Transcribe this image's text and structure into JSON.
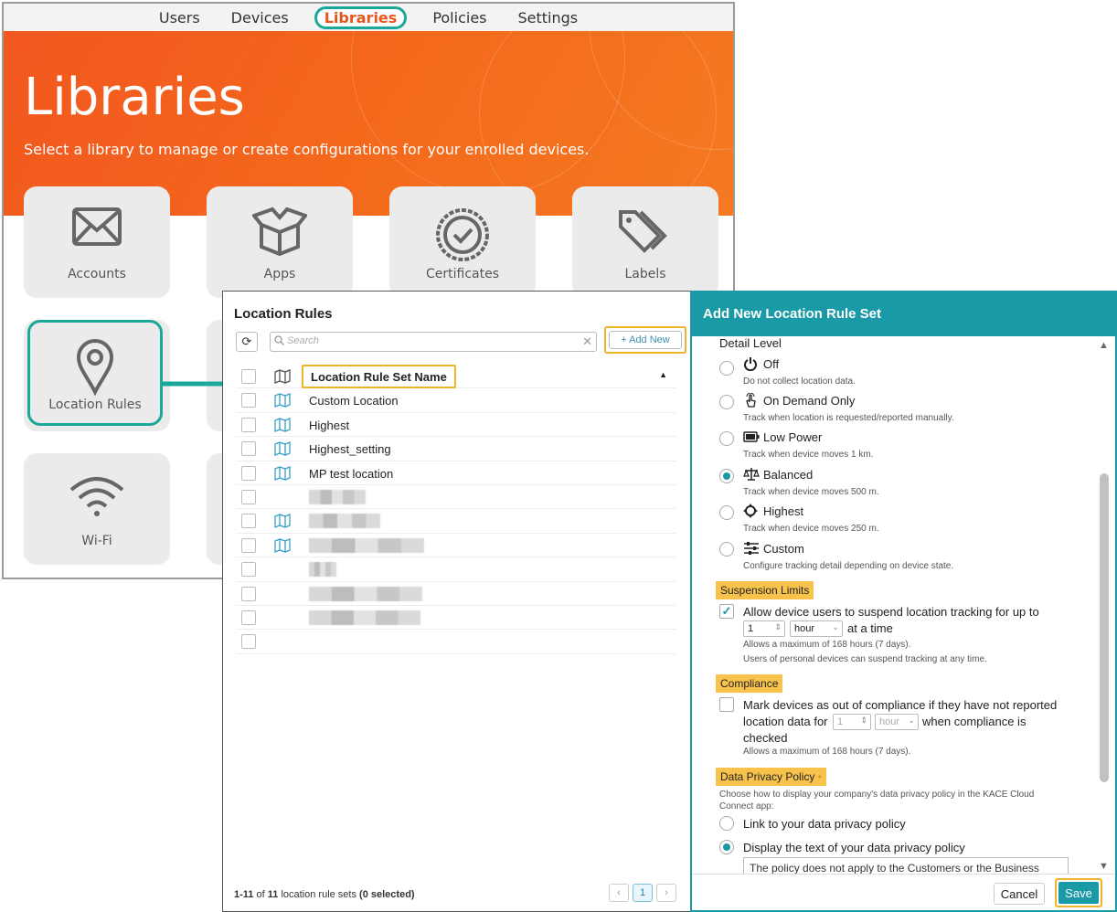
{
  "nav": {
    "items": [
      "Users",
      "Devices",
      "Libraries",
      "Policies",
      "Settings"
    ],
    "active_index": 2
  },
  "hero": {
    "title": "Libraries",
    "subtitle": "Select a library to manage or create configurations for your enrolled devices."
  },
  "tiles": [
    {
      "label": "Accounts",
      "icon": "envelope-icon"
    },
    {
      "label": "Apps",
      "icon": "box-icon"
    },
    {
      "label": "Certificates",
      "icon": "certificate-icon"
    },
    {
      "label": "Labels",
      "icon": "tag-icon"
    },
    {
      "label": "Location Rules",
      "icon": "map-pin-icon",
      "selected": true
    },
    {
      "label": "Wi-Fi",
      "icon": "wifi-icon"
    }
  ],
  "rules": {
    "title": "Location Rules",
    "search_placeholder": "Search",
    "add_new": "+ Add New",
    "column_header": "Location Rule Set Name",
    "rows": [
      "Custom Location",
      "Highest",
      "Highest_setting",
      "MP test location"
    ],
    "footer": {
      "range": "1-11",
      "of_word": "of",
      "total": "11",
      "suffix": "location rule sets",
      "selected": "(0 selected)"
    },
    "page": "1"
  },
  "addset": {
    "title": "Add New Location Rule Set",
    "detail_level_label": "Detail Level",
    "options": [
      {
        "label": "Off",
        "desc": "Do not collect location data.",
        "icon": "power-icon",
        "selected": false
      },
      {
        "label": "On Demand Only",
        "desc": "Track when location is requested/reported manually.",
        "icon": "hand-tap-icon",
        "selected": false
      },
      {
        "label": "Low Power",
        "desc": "Track when device moves 1 km.",
        "icon": "battery-icon",
        "selected": false
      },
      {
        "label": "Balanced",
        "desc": "Track when device moves 500 m.",
        "icon": "scale-icon",
        "selected": true
      },
      {
        "label": "Highest",
        "desc": "Track when device moves 250 m.",
        "icon": "crosshair-icon",
        "selected": false
      },
      {
        "label": "Custom",
        "desc": "Configure tracking detail depending on device state.",
        "icon": "sliders-icon",
        "selected": false
      }
    ],
    "suspension": {
      "heading": "Suspension Limits",
      "checkbox_label": "Allow device users to suspend location tracking for up to",
      "checked": true,
      "value": "1",
      "unit": "hour",
      "suffix": "at a time",
      "note1": "Allows a maximum of 168 hours (7 days).",
      "note2": "Users of personal devices can suspend tracking at any time."
    },
    "compliance": {
      "heading": "Compliance",
      "line1": "Mark devices as out of compliance if they have not reported",
      "line2_prefix": "location data for",
      "value": "1",
      "unit": "hour",
      "line2_suffix": "when compliance is",
      "line3": "checked",
      "note": "Allows a maximum of 168 hours (7 days).",
      "checked": false
    },
    "privacy": {
      "heading": "Data Privacy Policy",
      "required_marker": "•",
      "desc_line1": "Choose how to display your company's data privacy policy in the KACE Cloud",
      "desc_line2": "Connect app:",
      "option_link": "Link to your data privacy policy",
      "option_text": "Display the text of your data privacy policy",
      "selected": "text",
      "policy_text": "The policy does not apply to the Customers or the Business"
    },
    "cancel": "Cancel",
    "save": "Save"
  },
  "colors": {
    "accent_teal": "#1a9aa6",
    "hero_orange": "#f2571f",
    "highlight_amber": "#f0b429",
    "badge_yellow": "#f7c34d"
  }
}
